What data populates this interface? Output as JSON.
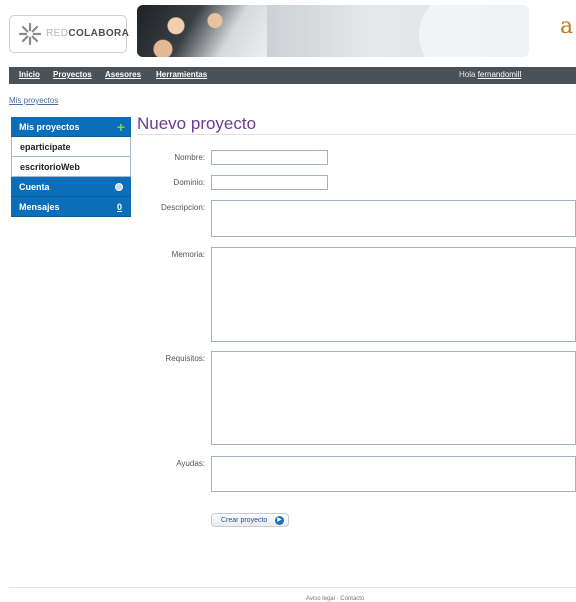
{
  "header": {
    "logo_light": "RED",
    "logo_dark": "COLABORA",
    "brand_right": "a"
  },
  "nav": {
    "items": [
      "Inicio",
      "Proyectos",
      "Asesores",
      "Herramientas"
    ],
    "greeting": "Hola",
    "username": "fernandomill"
  },
  "breadcrumb": "Mis proyectos",
  "sidebar": {
    "section_title": "Mis proyectos",
    "projects": [
      "eparticipate",
      "escritorioWeb"
    ],
    "cuenta": "Cuenta",
    "mensajes": "Mensajes",
    "mensajes_count": "0"
  },
  "form": {
    "title": "Nuevo proyecto",
    "labels": {
      "nombre": "Nombre:",
      "dominio": "Dominio:",
      "descripcion": "Descripcion:",
      "memoria": "Memoria:",
      "requisitos": "Requisitos:",
      "ayudas": "Ayudas:"
    },
    "submit": "Crear proyecto"
  },
  "footer": {
    "aviso": "Aviso legal",
    "sep": " · ",
    "contacto": "Contacto"
  },
  "colors": {
    "nav_bg": "#4a5259",
    "sidebar_blue": "#0a6fb8",
    "title_purple": "#6a3d8f"
  }
}
